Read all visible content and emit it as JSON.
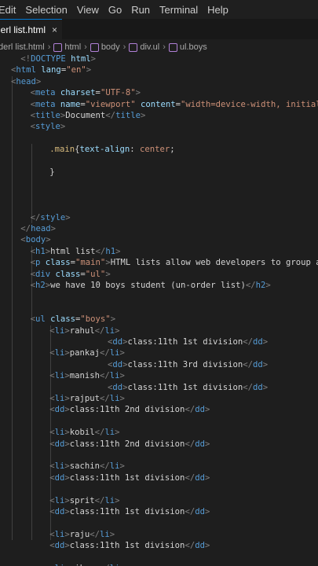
{
  "menu": [
    "Edit",
    "Selection",
    "View",
    "Go",
    "Run",
    "Terminal",
    "Help"
  ],
  "tab": {
    "label": "derl list.html",
    "close": "×"
  },
  "breadcrumb": [
    {
      "text": "derl list.html",
      "icon": ""
    },
    {
      "text": "html",
      "icon": "cube-icon"
    },
    {
      "text": "body",
      "icon": "cube-icon"
    },
    {
      "text": "div.ul",
      "icon": "cube-icon"
    },
    {
      "text": "ul.boys",
      "icon": "cube-icon"
    }
  ],
  "code": [
    {
      "i": 1,
      "s": [
        [
          "p",
          "<!"
        ],
        [
          "t",
          "DOCTYPE"
        ],
        [
          "x",
          " "
        ],
        [
          "a",
          "html"
        ],
        [
          "p",
          ">"
        ]
      ]
    },
    {
      "i": 0,
      "s": [
        [
          "p",
          "<"
        ],
        [
          "t",
          "html"
        ],
        [
          "x",
          " "
        ],
        [
          "a",
          "lang"
        ],
        [
          "x",
          "="
        ],
        [
          "s",
          "\"en\""
        ],
        [
          "p",
          ">"
        ]
      ]
    },
    {
      "i": 0,
      "s": [
        [
          "p",
          "<"
        ],
        [
          "t",
          "head"
        ],
        [
          "p",
          ">"
        ]
      ]
    },
    {
      "i": 2,
      "s": [
        [
          "p",
          "<"
        ],
        [
          "t",
          "meta"
        ],
        [
          "x",
          " "
        ],
        [
          "a",
          "charset"
        ],
        [
          "x",
          "="
        ],
        [
          "s",
          "\"UTF-8\""
        ],
        [
          "p",
          ">"
        ]
      ]
    },
    {
      "i": 2,
      "s": [
        [
          "p",
          "<"
        ],
        [
          "t",
          "meta"
        ],
        [
          "x",
          " "
        ],
        [
          "a",
          "name"
        ],
        [
          "x",
          "="
        ],
        [
          "s",
          "\"viewport\""
        ],
        [
          "x",
          " "
        ],
        [
          "a",
          "content"
        ],
        [
          "x",
          "="
        ],
        [
          "s",
          "\"width=device-width, initial-scal"
        ]
      ]
    },
    {
      "i": 2,
      "s": [
        [
          "p",
          "<"
        ],
        [
          "t",
          "title"
        ],
        [
          "p",
          ">"
        ],
        [
          "x",
          "Document"
        ],
        [
          "p",
          "</"
        ],
        [
          "t",
          "title"
        ],
        [
          "p",
          ">"
        ]
      ]
    },
    {
      "i": 2,
      "s": [
        [
          "p",
          "<"
        ],
        [
          "t",
          "style"
        ],
        [
          "p",
          ">"
        ]
      ]
    },
    {
      "i": 0,
      "s": []
    },
    {
      "i": 4,
      "s": [
        [
          "sel",
          ".main"
        ],
        [
          "x",
          "{"
        ],
        [
          "pr",
          "text-align"
        ],
        [
          "x",
          ": "
        ],
        [
          "s",
          "center"
        ],
        [
          "x",
          ";"
        ]
      ]
    },
    {
      "i": 0,
      "s": []
    },
    {
      "i": 4,
      "s": [
        [
          "x",
          "}"
        ]
      ]
    },
    {
      "i": 0,
      "s": []
    },
    {
      "i": 0,
      "s": []
    },
    {
      "i": 0,
      "s": []
    },
    {
      "i": 2,
      "s": [
        [
          "p",
          "</"
        ],
        [
          "t",
          "style"
        ],
        [
          "p",
          ">"
        ]
      ]
    },
    {
      "i": 1,
      "s": [
        [
          "p",
          "</"
        ],
        [
          "t",
          "head"
        ],
        [
          "p",
          ">"
        ]
      ]
    },
    {
      "i": 1,
      "s": [
        [
          "p",
          "<"
        ],
        [
          "t",
          "body"
        ],
        [
          "p",
          ">"
        ]
      ]
    },
    {
      "i": 2,
      "s": [
        [
          "p",
          "<"
        ],
        [
          "t",
          "h1"
        ],
        [
          "p",
          ">"
        ],
        [
          "x",
          "html list"
        ],
        [
          "p",
          "</"
        ],
        [
          "t",
          "h1"
        ],
        [
          "p",
          ">"
        ]
      ]
    },
    {
      "i": 2,
      "s": [
        [
          "p",
          "<"
        ],
        [
          "t",
          "p"
        ],
        [
          "x",
          " "
        ],
        [
          "a",
          "class"
        ],
        [
          "x",
          "="
        ],
        [
          "s",
          "\"main\""
        ],
        [
          "p",
          ">"
        ],
        [
          "x",
          "HTML lists allow web developers to group a set"
        ]
      ]
    },
    {
      "i": 2,
      "s": [
        [
          "p",
          "<"
        ],
        [
          "t",
          "div"
        ],
        [
          "x",
          " "
        ],
        [
          "a",
          "class"
        ],
        [
          "x",
          "="
        ],
        [
          "s",
          "\"ul\""
        ],
        [
          "p",
          ">"
        ]
      ]
    },
    {
      "i": 2,
      "s": [
        [
          "p",
          "<"
        ],
        [
          "t",
          "h2"
        ],
        [
          "p",
          ">"
        ],
        [
          "x",
          "we have 10 boys student (un-order list)"
        ],
        [
          "p",
          "</"
        ],
        [
          "t",
          "h2"
        ],
        [
          "p",
          ">"
        ]
      ]
    },
    {
      "i": 0,
      "s": []
    },
    {
      "i": 0,
      "s": []
    },
    {
      "i": 2,
      "s": [
        [
          "p",
          "<"
        ],
        [
          "t",
          "ul"
        ],
        [
          "x",
          " "
        ],
        [
          "a",
          "class"
        ],
        [
          "x",
          "="
        ],
        [
          "s",
          "\"boys\""
        ],
        [
          "p",
          ">"
        ]
      ]
    },
    {
      "i": 4,
      "s": [
        [
          "p",
          "<"
        ],
        [
          "t",
          "li"
        ],
        [
          "p",
          ">"
        ],
        [
          "x",
          "rahul"
        ],
        [
          "p",
          "</"
        ],
        [
          "t",
          "li"
        ],
        [
          "p",
          ">"
        ]
      ]
    },
    {
      "i": 10,
      "s": [
        [
          "p",
          "<"
        ],
        [
          "t",
          "dd"
        ],
        [
          "p",
          ">"
        ],
        [
          "x",
          "class:11th 1st division"
        ],
        [
          "p",
          "</"
        ],
        [
          "t",
          "dd"
        ],
        [
          "p",
          ">"
        ]
      ]
    },
    {
      "i": 4,
      "s": [
        [
          "p",
          "<"
        ],
        [
          "t",
          "li"
        ],
        [
          "p",
          ">"
        ],
        [
          "x",
          "pankaj"
        ],
        [
          "p",
          "</"
        ],
        [
          "t",
          "li"
        ],
        [
          "p",
          ">"
        ]
      ]
    },
    {
      "i": 10,
      "s": [
        [
          "p",
          "<"
        ],
        [
          "t",
          "dd"
        ],
        [
          "p",
          ">"
        ],
        [
          "x",
          "class:11th 3rd division"
        ],
        [
          "p",
          "</"
        ],
        [
          "t",
          "dd"
        ],
        [
          "p",
          ">"
        ]
      ]
    },
    {
      "i": 4,
      "s": [
        [
          "p",
          "<"
        ],
        [
          "t",
          "li"
        ],
        [
          "p",
          ">"
        ],
        [
          "x",
          "manish"
        ],
        [
          "p",
          "</"
        ],
        [
          "t",
          "li"
        ],
        [
          "p",
          ">"
        ]
      ]
    },
    {
      "i": 10,
      "s": [
        [
          "p",
          "<"
        ],
        [
          "t",
          "dd"
        ],
        [
          "p",
          ">"
        ],
        [
          "x",
          "class:11th 1st division"
        ],
        [
          "p",
          "</"
        ],
        [
          "t",
          "dd"
        ],
        [
          "p",
          ">"
        ]
      ]
    },
    {
      "i": 4,
      "s": [
        [
          "p",
          "<"
        ],
        [
          "t",
          "li"
        ],
        [
          "p",
          ">"
        ],
        [
          "x",
          "rajput"
        ],
        [
          "p",
          "</"
        ],
        [
          "t",
          "li"
        ],
        [
          "p",
          ">"
        ]
      ]
    },
    {
      "i": 4,
      "s": [
        [
          "p",
          "<"
        ],
        [
          "t",
          "dd"
        ],
        [
          "p",
          ">"
        ],
        [
          "x",
          "class:11th 2nd division"
        ],
        [
          "p",
          "</"
        ],
        [
          "t",
          "dd"
        ],
        [
          "p",
          ">"
        ]
      ]
    },
    {
      "i": 0,
      "s": []
    },
    {
      "i": 4,
      "s": [
        [
          "p",
          "<"
        ],
        [
          "t",
          "li"
        ],
        [
          "p",
          ">"
        ],
        [
          "x",
          "kobil"
        ],
        [
          "p",
          "</"
        ],
        [
          "t",
          "li"
        ],
        [
          "p",
          ">"
        ]
      ]
    },
    {
      "i": 4,
      "s": [
        [
          "p",
          "<"
        ],
        [
          "t",
          "dd"
        ],
        [
          "p",
          ">"
        ],
        [
          "x",
          "class:11th 2nd division"
        ],
        [
          "p",
          "</"
        ],
        [
          "t",
          "dd"
        ],
        [
          "p",
          ">"
        ]
      ]
    },
    {
      "i": 0,
      "s": []
    },
    {
      "i": 4,
      "s": [
        [
          "p",
          "<"
        ],
        [
          "t",
          "li"
        ],
        [
          "p",
          ">"
        ],
        [
          "x",
          "sachin"
        ],
        [
          "p",
          "</"
        ],
        [
          "t",
          "li"
        ],
        [
          "p",
          ">"
        ]
      ]
    },
    {
      "i": 4,
      "s": [
        [
          "p",
          "<"
        ],
        [
          "t",
          "dd"
        ],
        [
          "p",
          ">"
        ],
        [
          "x",
          "class:11th 1st division"
        ],
        [
          "p",
          "</"
        ],
        [
          "t",
          "dd"
        ],
        [
          "p",
          ">"
        ]
      ]
    },
    {
      "i": 0,
      "s": []
    },
    {
      "i": 4,
      "s": [
        [
          "p",
          "<"
        ],
        [
          "t",
          "li"
        ],
        [
          "p",
          ">"
        ],
        [
          "x",
          "sprit"
        ],
        [
          "p",
          "</"
        ],
        [
          "t",
          "li"
        ],
        [
          "p",
          ">"
        ]
      ]
    },
    {
      "i": 4,
      "s": [
        [
          "p",
          "<"
        ],
        [
          "t",
          "dd"
        ],
        [
          "p",
          ">"
        ],
        [
          "x",
          "class:11th 1st division"
        ],
        [
          "p",
          "</"
        ],
        [
          "t",
          "dd"
        ],
        [
          "p",
          ">"
        ]
      ]
    },
    {
      "i": 0,
      "s": []
    },
    {
      "i": 4,
      "s": [
        [
          "p",
          "<"
        ],
        [
          "t",
          "li"
        ],
        [
          "p",
          ">"
        ],
        [
          "x",
          "raju"
        ],
        [
          "p",
          "</"
        ],
        [
          "t",
          "li"
        ],
        [
          "p",
          ">"
        ]
      ]
    },
    {
      "i": 4,
      "s": [
        [
          "p",
          "<"
        ],
        [
          "t",
          "dd"
        ],
        [
          "p",
          ">"
        ],
        [
          "x",
          "class:11th 1st division"
        ],
        [
          "p",
          "</"
        ],
        [
          "t",
          "dd"
        ],
        [
          "p",
          ">"
        ]
      ]
    },
    {
      "i": 0,
      "s": []
    },
    {
      "i": 4,
      "s": [
        [
          "p",
          "<"
        ],
        [
          "t",
          "li"
        ],
        [
          "p",
          ">"
        ],
        [
          "x",
          "vikram"
        ],
        [
          "p",
          "</"
        ],
        [
          "t",
          "li"
        ],
        [
          "p",
          ">"
        ]
      ]
    }
  ]
}
